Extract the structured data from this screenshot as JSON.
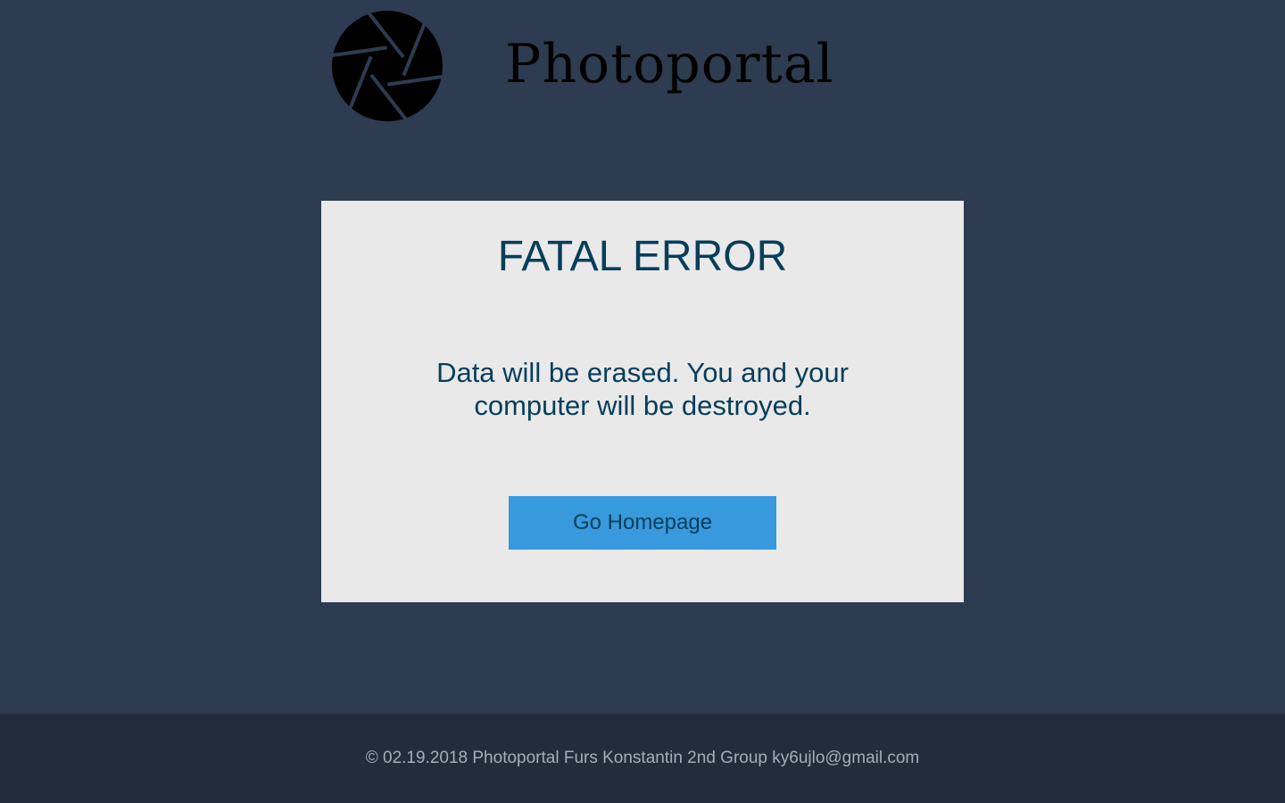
{
  "header": {
    "logo_icon": "camera-aperture-icon",
    "site_title": "Photoportal"
  },
  "error": {
    "title": "FATAL ERROR",
    "message": "Data will be erased. You and your computer will be destroyed.",
    "button_label": "Go Homepage"
  },
  "footer": {
    "text": "© 02.19.2018 Photoportal Furs Konstantin 2nd Group ky6ujlo@gmail.com"
  },
  "colors": {
    "page_background": "#2d3c50",
    "card_background": "#e9e9ea",
    "heading_text": "#073e5a",
    "button_background": "#3899dd",
    "footer_background": "#222d3c",
    "footer_text": "#a5adb6"
  }
}
